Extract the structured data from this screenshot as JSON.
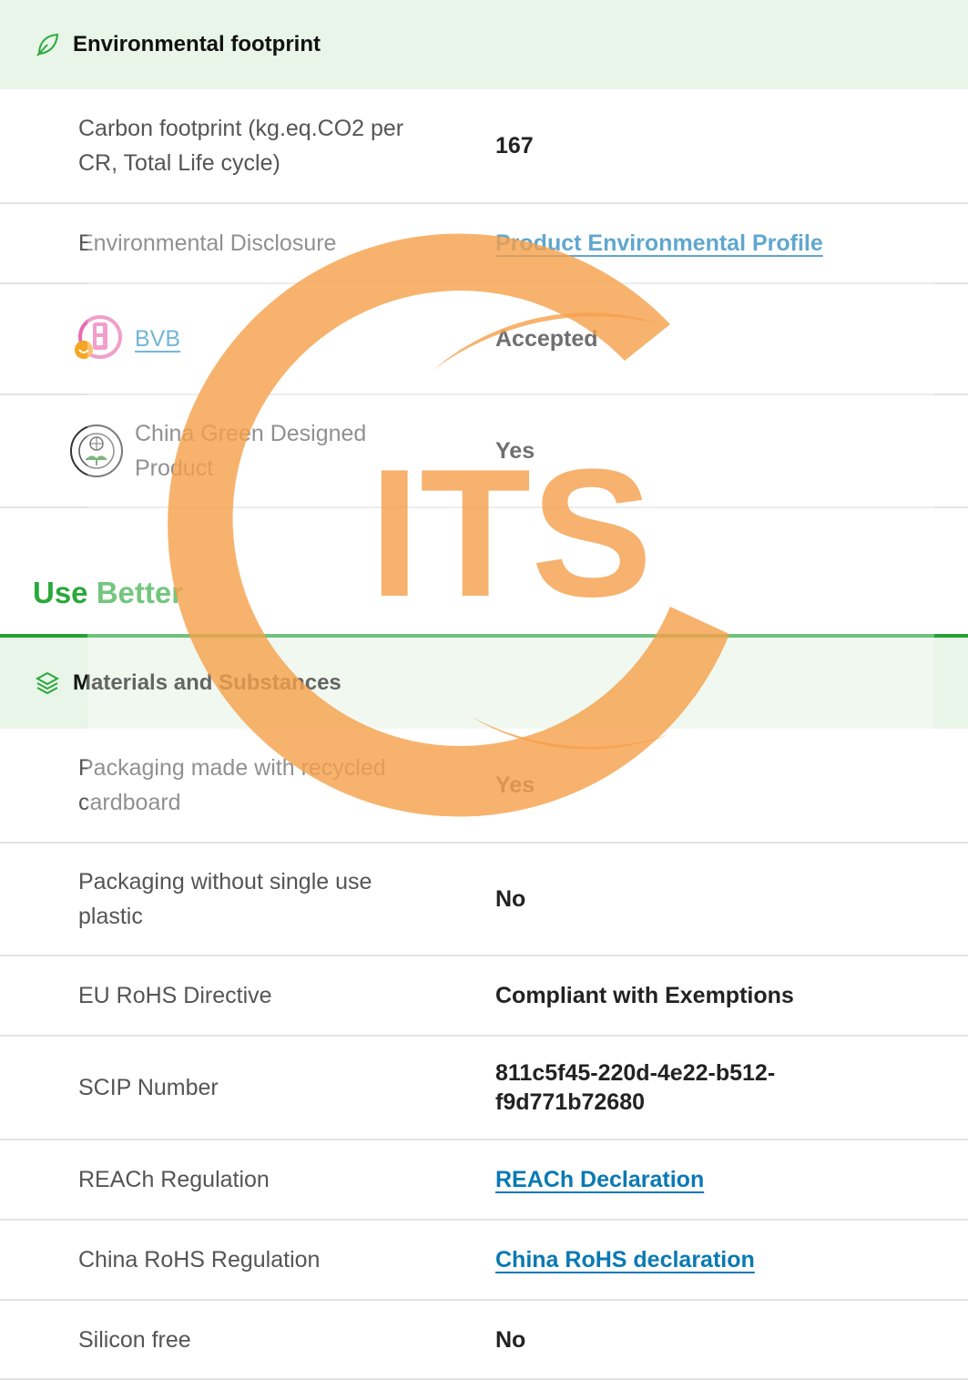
{
  "env_section": {
    "title": "Environmental footprint",
    "rows": [
      {
        "label": "Carbon footprint (kg.eq.CO2 per CR, Total Life cycle)",
        "value": "167"
      },
      {
        "label": "Environmental Disclosure",
        "value": "Product Environmental Profile"
      },
      {
        "label": "BVB",
        "value": "Accepted"
      },
      {
        "label": "China Green Designed Product",
        "value": "Yes"
      }
    ]
  },
  "use_better": {
    "title": "Use Better"
  },
  "materials_section": {
    "title": "Materials and Substances",
    "rows": [
      {
        "label": "Packaging made with recycled cardboard",
        "value": "Yes"
      },
      {
        "label": "Packaging without single use plastic",
        "value": "No"
      },
      {
        "label": "EU RoHS Directive",
        "value": "Compliant with Exemptions"
      },
      {
        "label": "SCIP Number",
        "value": "811c5f45-220d-4e22-b512-f9d771b72680"
      },
      {
        "label": "REACh Regulation",
        "value": "REACh Declaration"
      },
      {
        "label": "China RoHS Regulation",
        "value": "China RoHS declaration"
      },
      {
        "label": "Silicon free",
        "value": "No"
      }
    ]
  },
  "watermark": {
    "text": "ITS"
  },
  "icons": {
    "leaf": "leaf-icon",
    "layers": "layers-icon",
    "bvb": "bvb-logo-icon",
    "eco": "eco-design-logo-icon"
  },
  "colors": {
    "accent_green": "#2aa83a",
    "header_bg": "#e8f5e8",
    "link_blue": "#0a79b4",
    "watermark_orange": "#f5a04a"
  }
}
